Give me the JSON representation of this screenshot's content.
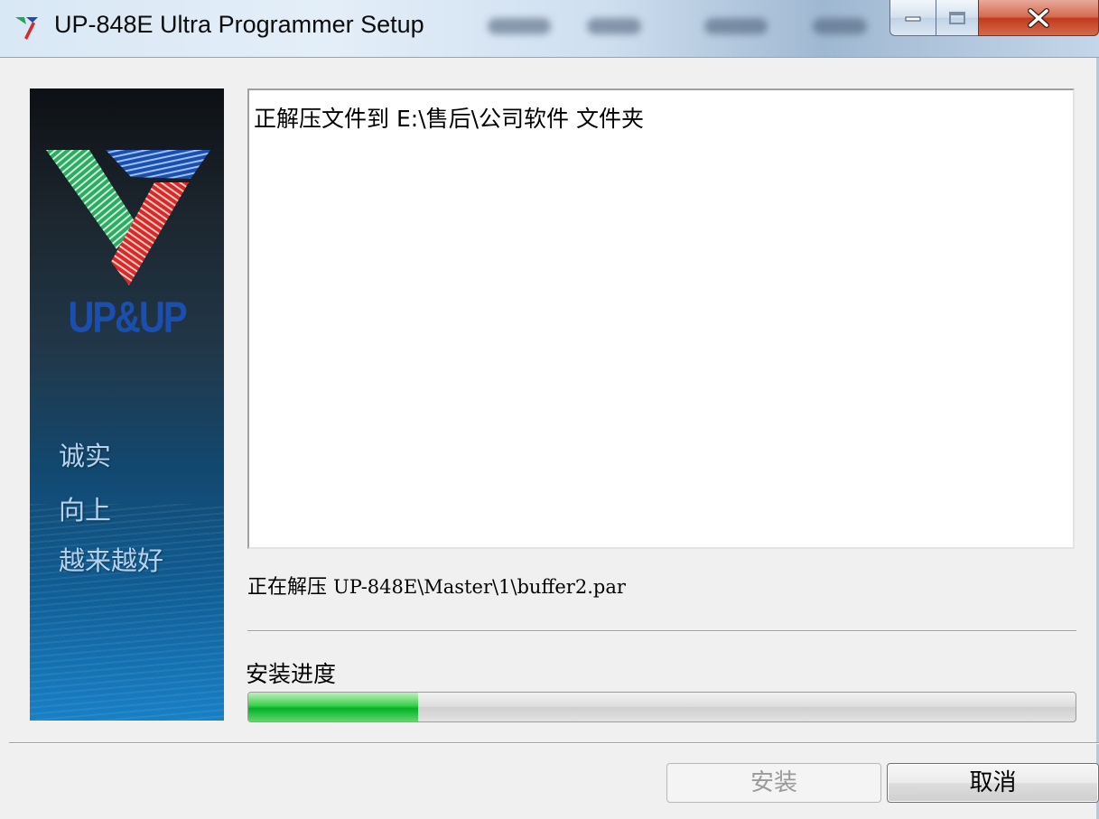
{
  "window": {
    "title": "UP-848E Ultra Programmer Setup",
    "controls": {
      "minimize": "minimize",
      "maximize": "maximize",
      "close": "close"
    }
  },
  "banner": {
    "logo_text": "UP&UP",
    "slogans": [
      "诚实",
      "向上",
      "越来越好"
    ]
  },
  "log": {
    "line_prefix": "正解压文件到",
    "path": "E:\\售后\\公司软件",
    "line_suffix": "文件夹"
  },
  "status": {
    "prefix": "正在解压",
    "file": "UP-848E\\Master\\1\\buffer2.par"
  },
  "progress": {
    "label": "安装进度",
    "percent": 20.5
  },
  "buttons": {
    "install": "安装",
    "cancel": "取消"
  },
  "colors": {
    "progress_green": "#06b029",
    "logo_blue": "#1a4fb0",
    "logo_green": "#2eaa62",
    "logo_red": "#d52a2a"
  }
}
